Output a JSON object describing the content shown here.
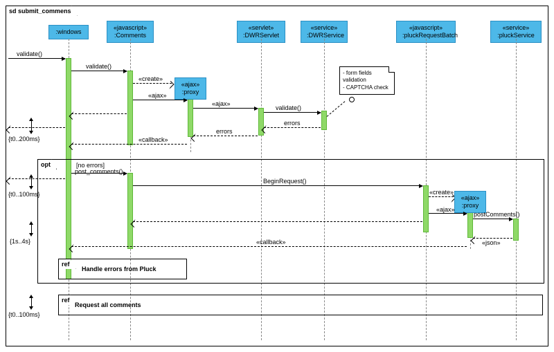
{
  "diagram": {
    "title": "sd submit_commens",
    "lifelines": {
      "windows": {
        "label": ":windows",
        "stereotype": ""
      },
      "comments": {
        "label": ":Comments",
        "stereotype": "«javascript»"
      },
      "proxy1": {
        "label": ":proxy",
        "stereotype": "«ajax»"
      },
      "dwrservlet": {
        "label": ":DWRServlet",
        "stereotype": "«servlet»"
      },
      "dwrservice": {
        "label": ":DWRService",
        "stereotype": "«service»"
      },
      "pluckbatch": {
        "label": ":pluckRequestBatch",
        "stereotype": "«javascript»"
      },
      "proxy2": {
        "label": ":proxy",
        "stereotype": "«ajax»"
      },
      "pluckservice": {
        "label": ":pluckService",
        "stereotype": "«service»"
      }
    },
    "messages": {
      "validate1": "validate()",
      "validate2": "validate()",
      "create1": "«create»",
      "ajax1": "«ajax»",
      "ajax2": "«ajax»",
      "validate3": "validate()",
      "errors1": "errors",
      "errors2": "errors",
      "callback1": "«callback»",
      "postcomments": "post_comments()",
      "beginreq": "BeginRequest()",
      "create2": "«create»",
      "ajax3": "«ajax»",
      "postcomments2": "postComments()",
      "json": "«json»",
      "callback2": "«callback»"
    },
    "fragments": {
      "opt": {
        "label": "opt",
        "guard": "[no errors]"
      },
      "ref1": {
        "label": "ref",
        "text": "Handle errors from Pluck"
      },
      "ref2": {
        "label": "ref",
        "text": "Request all comments"
      }
    },
    "note": {
      "line1": "- form fields",
      "line2": "validation",
      "line3": "- CAPTCHA check"
    },
    "timings": {
      "t1": "{t0..200ms}",
      "t2": "{t0..100ms}",
      "t3": "{1s..4s}",
      "t4": "{t0..100ms}"
    }
  }
}
